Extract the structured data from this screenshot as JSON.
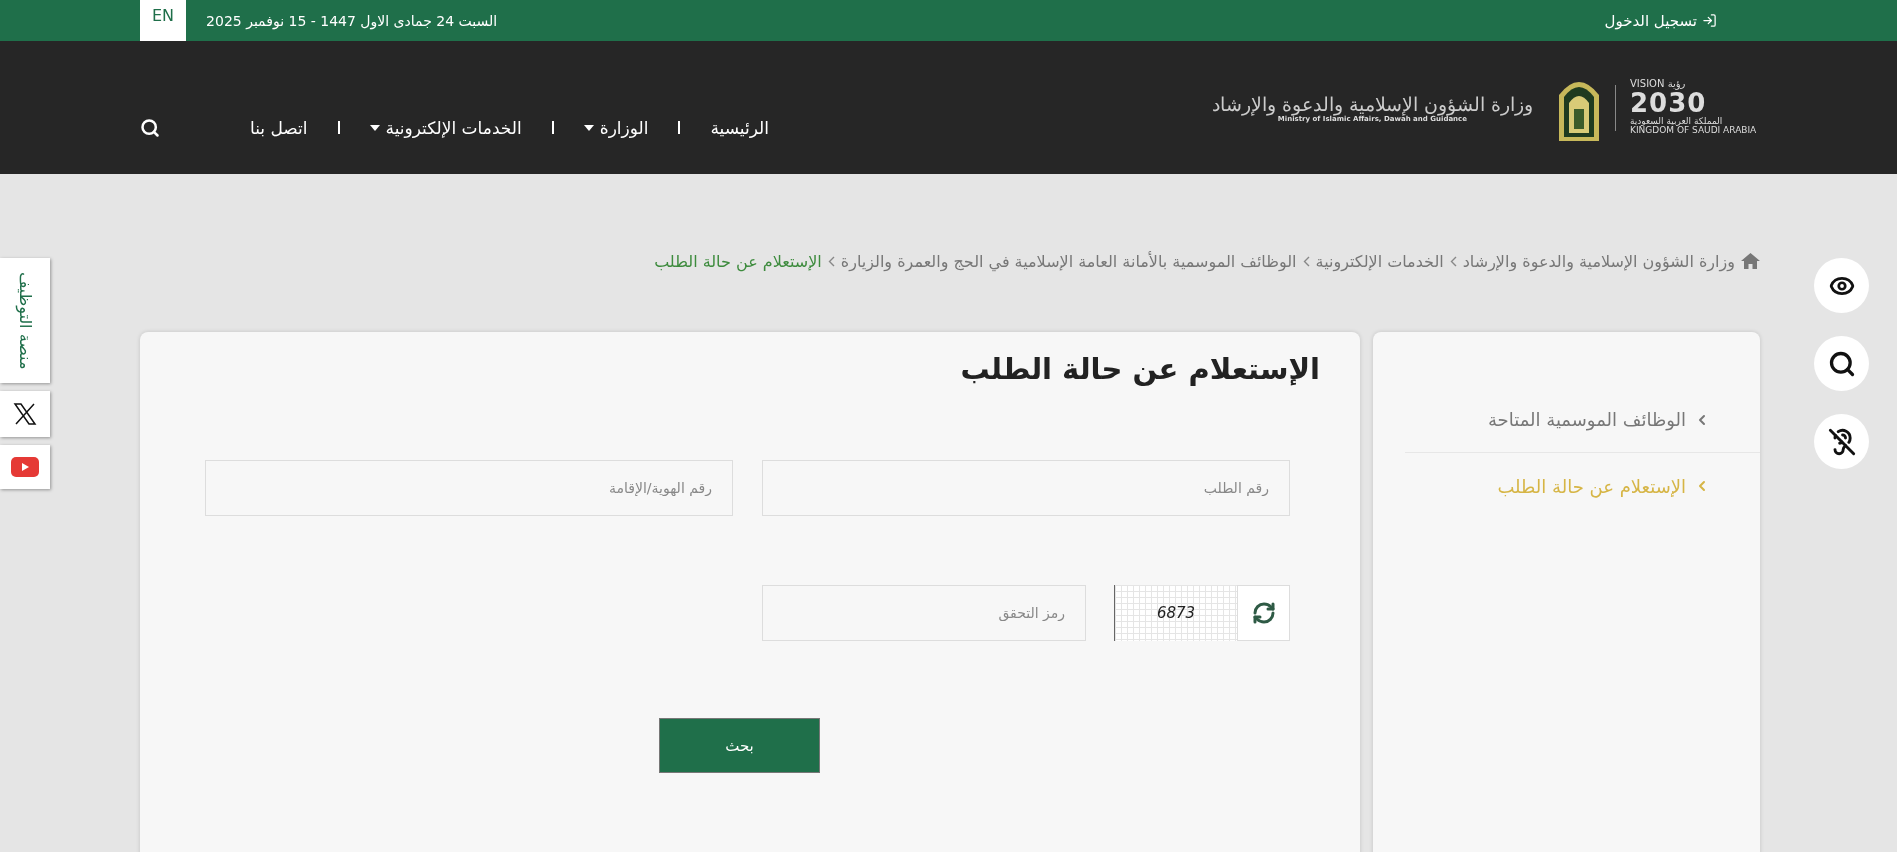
{
  "top_bar": {
    "login": "تسجيل الدخول",
    "date": "السبت 24 جمادى الاول 1447 - 15 نوفمبر 2025",
    "language": "EN"
  },
  "header": {
    "ministry_ar": "وزارة الشؤون الإسلامية والدعوة والإرشاد",
    "ministry_en": "Ministry of Islamic Affairs, Dawah and Guidance",
    "vision_ar": "رؤية",
    "vision_label": "VISION",
    "vision_year": "2030",
    "vision_country_ar": "المملكة العربية السعودية",
    "vision_country_en": "KINGDOM OF SAUDI ARABIA",
    "nav": [
      {
        "label": "الرئيسية",
        "dropdown": false
      },
      {
        "label": "الوزارة",
        "dropdown": true
      },
      {
        "label": "الخدمات الإلكترونية",
        "dropdown": true
      },
      {
        "label": "اتصل بنا",
        "dropdown": false
      }
    ]
  },
  "breadcrumb": [
    {
      "label": "وزارة الشؤون الإسلامية والدعوة والإرشاد",
      "selected": false
    },
    {
      "label": "الخدمات الإلكترونية",
      "selected": false
    },
    {
      "label": "الوظائف الموسمية بالأمانة العامة الإسلامية في الحج والعمرة والزيارة",
      "selected": false
    },
    {
      "label": "الإستعلام عن حالة الطلب",
      "selected": true
    }
  ],
  "sidebar": {
    "items": [
      {
        "label": "الوظائف الموسمية المتاحة",
        "selected": false
      },
      {
        "label": "الإستعلام عن حالة الطلب",
        "selected": true
      }
    ]
  },
  "form": {
    "title": "الإستعلام عن حالة الطلب",
    "fields": [
      {
        "placeholder": "رقم الطلب"
      },
      {
        "placeholder": "رقم الهوية/الإقامة"
      }
    ],
    "captcha": {
      "placeholder": "رمز التحقق",
      "code": "6873"
    },
    "submit": "بحث"
  },
  "side_tabs": [
    {
      "kind": "text",
      "label": "منصة التوظيف"
    },
    {
      "kind": "x"
    },
    {
      "kind": "youtube"
    }
  ]
}
